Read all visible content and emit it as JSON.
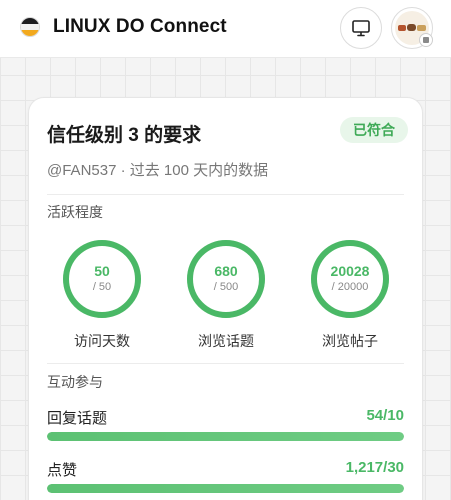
{
  "header": {
    "title": "LINUX DO Connect",
    "monitor_icon": "monitor-icon",
    "avatar": "user-avatar"
  },
  "card": {
    "title": "信任级别 3 的要求",
    "status": "已符合",
    "subtitle": "@FAN537 · 过去 100 天内的数据",
    "activity": {
      "label": "活跃程度",
      "rings": [
        {
          "value": "50",
          "required": "/ 50",
          "label": "访问天数",
          "progress": 1.0
        },
        {
          "value": "680",
          "required": "/ 500",
          "label": "浏览话题",
          "progress": 1.0
        },
        {
          "value": "20028",
          "required": "/ 20000",
          "label": "浏览帖子",
          "progress": 1.0
        }
      ]
    },
    "interaction": {
      "label": "互动参与",
      "rows": [
        {
          "label": "回复话题",
          "value": "54/10",
          "progress": 1.0
        },
        {
          "label": "点赞",
          "value": "1,217/30",
          "progress": 1.0
        }
      ]
    }
  },
  "colors": {
    "accent_green": "#4ab866",
    "badge_bg": "#e8f6ea",
    "ring_track": "#dff2e3"
  }
}
